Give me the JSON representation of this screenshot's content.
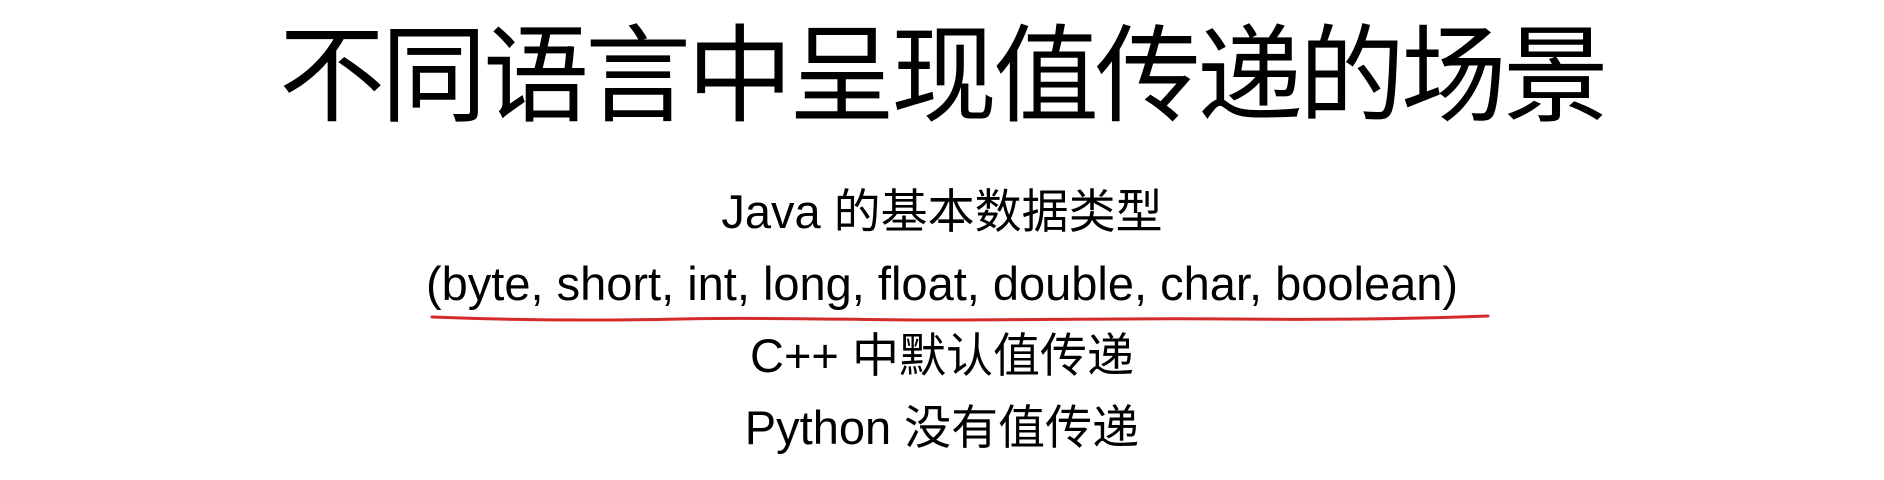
{
  "slide": {
    "title": "不同语言中呈现值传递的场景",
    "lines": [
      "Java 的基本数据类型",
      "(byte, short, int, long, float, double, char, boolean)",
      "C++ 中默认值传递",
      "Python 没有值传递"
    ]
  },
  "colors": {
    "text": "#000000",
    "annotation_underline": "#d42a2a",
    "background": "#ffffff"
  }
}
